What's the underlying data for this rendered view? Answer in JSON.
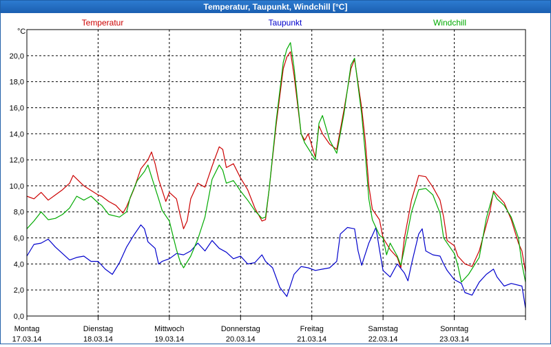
{
  "window": {
    "title": "Temperatur, Taupunkt, Windchill [°C]"
  },
  "chart_data": {
    "type": "line",
    "title": "Temperatur, Taupunkt, Windchill [°C]",
    "ylabel": "°C",
    "xlabel": "",
    "ylim": [
      0,
      22
    ],
    "xlim": [
      0,
      7
    ],
    "grid": true,
    "y_ticks": [
      "0,0",
      "2,0",
      "4,0",
      "6,0",
      "8,0",
      "10,0",
      "12,0",
      "14,0",
      "16,0",
      "18,0",
      "20,0"
    ],
    "x_ticks": [
      {
        "day": "Montag",
        "date": "17.03.14"
      },
      {
        "day": "Dienstag",
        "date": "18.03.14"
      },
      {
        "day": "Mittwoch",
        "date": "19.03.14"
      },
      {
        "day": "Donnerstag",
        "date": "20.03.14"
      },
      {
        "day": "Freitag",
        "date": "21.03.14"
      },
      {
        "day": "Samstag",
        "date": "22.03.14"
      },
      {
        "day": "Sonntag",
        "date": "23.03.14"
      }
    ],
    "legend_placement": "top",
    "series": [
      {
        "name": "Temperatur",
        "color": "#cc0000",
        "points": [
          [
            0.0,
            9.2
          ],
          [
            0.1,
            9.0
          ],
          [
            0.2,
            9.5
          ],
          [
            0.3,
            8.9
          ],
          [
            0.4,
            9.3
          ],
          [
            0.5,
            9.7
          ],
          [
            0.6,
            10.2
          ],
          [
            0.65,
            10.8
          ],
          [
            0.8,
            10.0
          ],
          [
            1.0,
            9.3
          ],
          [
            1.05,
            9.2
          ],
          [
            1.15,
            8.8
          ],
          [
            1.25,
            8.5
          ],
          [
            1.35,
            7.9
          ],
          [
            1.4,
            8.4
          ],
          [
            1.5,
            9.7
          ],
          [
            1.6,
            11.3
          ],
          [
            1.7,
            12.0
          ],
          [
            1.75,
            12.6
          ],
          [
            1.8,
            11.7
          ],
          [
            1.85,
            10.5
          ],
          [
            1.95,
            8.8
          ],
          [
            2.0,
            9.5
          ],
          [
            2.1,
            9.0
          ],
          [
            2.15,
            7.8
          ],
          [
            2.2,
            6.7
          ],
          [
            2.25,
            7.3
          ],
          [
            2.3,
            9.0
          ],
          [
            2.4,
            10.2
          ],
          [
            2.5,
            9.9
          ],
          [
            2.6,
            11.5
          ],
          [
            2.7,
            13.0
          ],
          [
            2.75,
            12.8
          ],
          [
            2.8,
            11.4
          ],
          [
            2.9,
            11.7
          ],
          [
            3.0,
            10.6
          ],
          [
            3.1,
            9.7
          ],
          [
            3.2,
            8.3
          ],
          [
            3.3,
            7.3
          ],
          [
            3.35,
            7.4
          ],
          [
            3.4,
            9.7
          ],
          [
            3.5,
            14.7
          ],
          [
            3.6,
            19.0
          ],
          [
            3.65,
            19.9
          ],
          [
            3.7,
            20.3
          ],
          [
            3.75,
            18.5
          ],
          [
            3.85,
            14.0
          ],
          [
            3.9,
            13.5
          ],
          [
            3.95,
            14.0
          ],
          [
            4.05,
            12.2
          ],
          [
            4.1,
            14.6
          ],
          [
            4.15,
            14.0
          ],
          [
            4.25,
            13.2
          ],
          [
            4.35,
            12.8
          ],
          [
            4.45,
            15.8
          ],
          [
            4.55,
            19.0
          ],
          [
            4.6,
            19.7
          ],
          [
            4.7,
            16.0
          ],
          [
            4.75,
            13.5
          ],
          [
            4.8,
            10.0
          ],
          [
            4.85,
            8.2
          ],
          [
            4.95,
            7.4
          ],
          [
            5.0,
            6.0
          ],
          [
            5.1,
            5.1
          ],
          [
            5.2,
            4.5
          ],
          [
            5.25,
            3.7
          ],
          [
            5.3,
            6.0
          ],
          [
            5.4,
            8.9
          ],
          [
            5.5,
            10.8
          ],
          [
            5.6,
            10.7
          ],
          [
            5.7,
            9.9
          ],
          [
            5.8,
            8.9
          ],
          [
            5.85,
            7.6
          ],
          [
            5.9,
            5.8
          ],
          [
            6.0,
            5.4
          ],
          [
            6.05,
            4.6
          ],
          [
            6.15,
            4.0
          ],
          [
            6.25,
            3.8
          ],
          [
            6.35,
            5.0
          ],
          [
            6.5,
            8.0
          ],
          [
            6.55,
            9.6
          ],
          [
            6.6,
            9.3
          ],
          [
            6.7,
            8.7
          ],
          [
            6.8,
            7.4
          ],
          [
            6.9,
            5.6
          ],
          [
            6.95,
            5.0
          ],
          [
            7.0,
            3.4
          ]
        ]
      },
      {
        "name": "Taupunkt",
        "color": "#0000cc",
        "points": [
          [
            0.0,
            4.6
          ],
          [
            0.1,
            5.5
          ],
          [
            0.2,
            5.6
          ],
          [
            0.3,
            5.9
          ],
          [
            0.4,
            5.3
          ],
          [
            0.5,
            4.8
          ],
          [
            0.6,
            4.3
          ],
          [
            0.7,
            4.5
          ],
          [
            0.8,
            4.6
          ],
          [
            0.9,
            4.2
          ],
          [
            1.0,
            4.2
          ],
          [
            1.1,
            3.6
          ],
          [
            1.2,
            3.2
          ],
          [
            1.3,
            4.1
          ],
          [
            1.4,
            5.3
          ],
          [
            1.5,
            6.2
          ],
          [
            1.6,
            7.0
          ],
          [
            1.65,
            6.7
          ],
          [
            1.7,
            5.7
          ],
          [
            1.8,
            5.2
          ],
          [
            1.85,
            4.0
          ],
          [
            1.9,
            4.2
          ],
          [
            2.0,
            4.4
          ],
          [
            2.1,
            4.8
          ],
          [
            2.2,
            4.7
          ],
          [
            2.3,
            5.0
          ],
          [
            2.4,
            5.6
          ],
          [
            2.5,
            5.0
          ],
          [
            2.6,
            5.8
          ],
          [
            2.7,
            5.2
          ],
          [
            2.8,
            4.9
          ],
          [
            2.9,
            4.4
          ],
          [
            3.0,
            4.6
          ],
          [
            3.1,
            4.0
          ],
          [
            3.2,
            4.1
          ],
          [
            3.3,
            4.7
          ],
          [
            3.35,
            4.2
          ],
          [
            3.45,
            3.7
          ],
          [
            3.55,
            2.2
          ],
          [
            3.65,
            1.5
          ],
          [
            3.75,
            3.2
          ],
          [
            3.85,
            3.8
          ],
          [
            3.95,
            3.7
          ],
          [
            4.05,
            3.5
          ],
          [
            4.15,
            3.6
          ],
          [
            4.25,
            3.7
          ],
          [
            4.35,
            4.2
          ],
          [
            4.4,
            6.3
          ],
          [
            4.5,
            6.8
          ],
          [
            4.6,
            6.7
          ],
          [
            4.65,
            5.0
          ],
          [
            4.7,
            3.9
          ],
          [
            4.8,
            5.6
          ],
          [
            4.9,
            6.8
          ],
          [
            4.95,
            5.1
          ],
          [
            5.0,
            3.5
          ],
          [
            5.1,
            3.0
          ],
          [
            5.2,
            4.0
          ],
          [
            5.3,
            3.3
          ],
          [
            5.35,
            2.7
          ],
          [
            5.4,
            4.0
          ],
          [
            5.5,
            6.3
          ],
          [
            5.55,
            6.7
          ],
          [
            5.6,
            5.0
          ],
          [
            5.7,
            4.7
          ],
          [
            5.8,
            4.6
          ],
          [
            5.85,
            4.0
          ],
          [
            5.9,
            3.5
          ],
          [
            6.0,
            2.8
          ],
          [
            6.1,
            2.5
          ],
          [
            6.15,
            1.8
          ],
          [
            6.25,
            1.6
          ],
          [
            6.35,
            2.6
          ],
          [
            6.45,
            3.2
          ],
          [
            6.55,
            3.6
          ],
          [
            6.6,
            3.0
          ],
          [
            6.7,
            2.3
          ],
          [
            6.8,
            2.5
          ],
          [
            6.95,
            2.3
          ],
          [
            7.0,
            0.6
          ]
        ]
      },
      {
        "name": "Windchill",
        "color": "#00aa00",
        "points": [
          [
            0.0,
            6.7
          ],
          [
            0.1,
            7.3
          ],
          [
            0.2,
            8.0
          ],
          [
            0.3,
            7.4
          ],
          [
            0.4,
            7.5
          ],
          [
            0.5,
            7.8
          ],
          [
            0.6,
            8.3
          ],
          [
            0.7,
            9.2
          ],
          [
            0.8,
            8.9
          ],
          [
            0.9,
            9.2
          ],
          [
            1.0,
            8.7
          ],
          [
            1.05,
            8.5
          ],
          [
            1.15,
            7.8
          ],
          [
            1.3,
            7.6
          ],
          [
            1.4,
            8.0
          ],
          [
            1.45,
            9.1
          ],
          [
            1.55,
            10.4
          ],
          [
            1.65,
            11.1
          ],
          [
            1.7,
            11.6
          ],
          [
            1.75,
            10.7
          ],
          [
            1.85,
            9.0
          ],
          [
            1.9,
            8.1
          ],
          [
            2.0,
            7.3
          ],
          [
            2.05,
            6.2
          ],
          [
            2.1,
            5.1
          ],
          [
            2.15,
            4.2
          ],
          [
            2.2,
            3.7
          ],
          [
            2.3,
            4.6
          ],
          [
            2.4,
            5.9
          ],
          [
            2.5,
            7.6
          ],
          [
            2.6,
            10.5
          ],
          [
            2.7,
            11.6
          ],
          [
            2.75,
            11.2
          ],
          [
            2.8,
            10.2
          ],
          [
            2.9,
            10.4
          ],
          [
            3.0,
            9.6
          ],
          [
            3.1,
            8.9
          ],
          [
            3.2,
            8.1
          ],
          [
            3.3,
            7.5
          ],
          [
            3.35,
            7.6
          ],
          [
            3.4,
            9.7
          ],
          [
            3.5,
            15.0
          ],
          [
            3.6,
            19.5
          ],
          [
            3.65,
            20.5
          ],
          [
            3.7,
            21.0
          ],
          [
            3.75,
            19.1
          ],
          [
            3.85,
            14.0
          ],
          [
            3.9,
            13.3
          ],
          [
            4.05,
            12.0
          ],
          [
            4.1,
            14.8
          ],
          [
            4.15,
            15.4
          ],
          [
            4.25,
            13.5
          ],
          [
            4.35,
            12.5
          ],
          [
            4.45,
            15.5
          ],
          [
            4.55,
            19.3
          ],
          [
            4.6,
            19.8
          ],
          [
            4.7,
            15.5
          ],
          [
            4.75,
            12.5
          ],
          [
            4.8,
            9.0
          ],
          [
            4.85,
            7.4
          ],
          [
            4.95,
            6.2
          ],
          [
            5.0,
            6.0
          ],
          [
            5.05,
            4.7
          ],
          [
            5.1,
            5.6
          ],
          [
            5.2,
            4.6
          ],
          [
            5.25,
            3.9
          ],
          [
            5.3,
            5.2
          ],
          [
            5.4,
            8.0
          ],
          [
            5.5,
            9.7
          ],
          [
            5.6,
            9.8
          ],
          [
            5.7,
            9.3
          ],
          [
            5.8,
            7.9
          ],
          [
            5.85,
            6.0
          ],
          [
            5.9,
            5.6
          ],
          [
            6.0,
            4.8
          ],
          [
            6.05,
            3.9
          ],
          [
            6.1,
            2.6
          ],
          [
            6.2,
            3.2
          ],
          [
            6.35,
            4.5
          ],
          [
            6.45,
            7.5
          ],
          [
            6.55,
            9.5
          ],
          [
            6.6,
            9.0
          ],
          [
            6.7,
            8.5
          ],
          [
            6.8,
            7.6
          ],
          [
            6.9,
            6.0
          ],
          [
            6.95,
            4.0
          ],
          [
            7.0,
            2.6
          ]
        ]
      }
    ]
  }
}
